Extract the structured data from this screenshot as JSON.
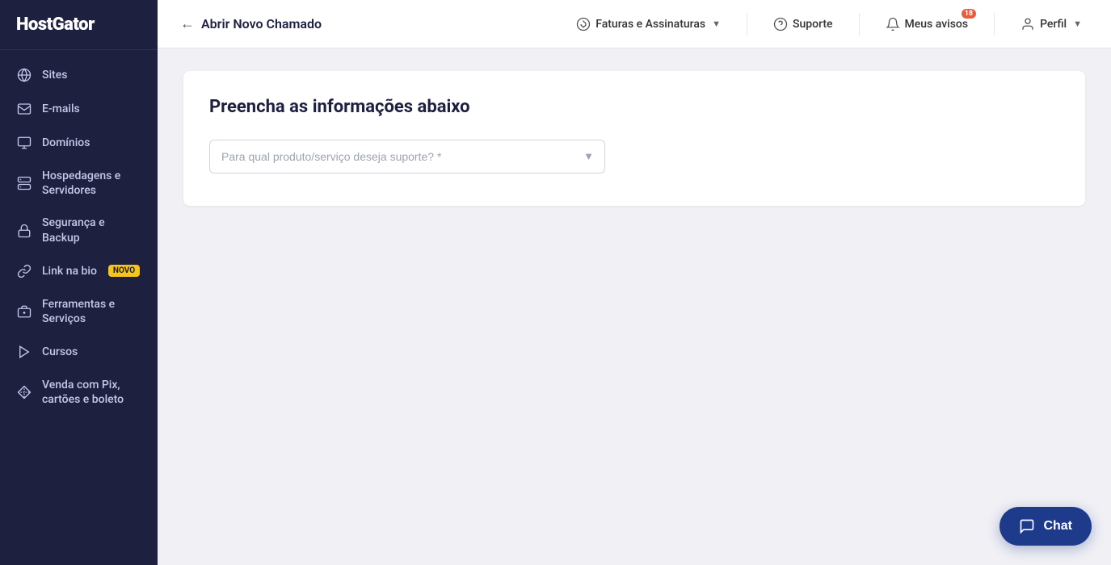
{
  "brand": "HostGator",
  "sidebar": {
    "items": [
      {
        "id": "sites",
        "label": "Sites",
        "icon": "globe"
      },
      {
        "id": "emails",
        "label": "E-mails",
        "icon": "email"
      },
      {
        "id": "dominios",
        "label": "Domínios",
        "icon": "domain"
      },
      {
        "id": "hospedagens",
        "label": "Hospedagens e Servidores",
        "icon": "server"
      },
      {
        "id": "seguranca",
        "label": "Segurança e Backup",
        "icon": "lock"
      },
      {
        "id": "linkbio",
        "label": "Link na bio",
        "icon": "link",
        "badge": "NOVO"
      },
      {
        "id": "ferramentas",
        "label": "Ferramentas e Serviços",
        "icon": "tools"
      },
      {
        "id": "cursos",
        "label": "Cursos",
        "icon": "play"
      },
      {
        "id": "venda",
        "label": "Venda com Pix, cartões e boleto",
        "icon": "pix"
      }
    ]
  },
  "topnav": {
    "back_label": "Abrir Novo Chamado",
    "billing_label": "Faturas e Assinaturas",
    "support_label": "Suporte",
    "notifications_label": "Meus avisos",
    "notifications_count": "18",
    "profile_label": "Perfil"
  },
  "form": {
    "title": "Preencha as informações abaixo",
    "select_placeholder": "Para qual produto/serviço deseja suporte? *"
  },
  "chat": {
    "label": "Chat"
  }
}
